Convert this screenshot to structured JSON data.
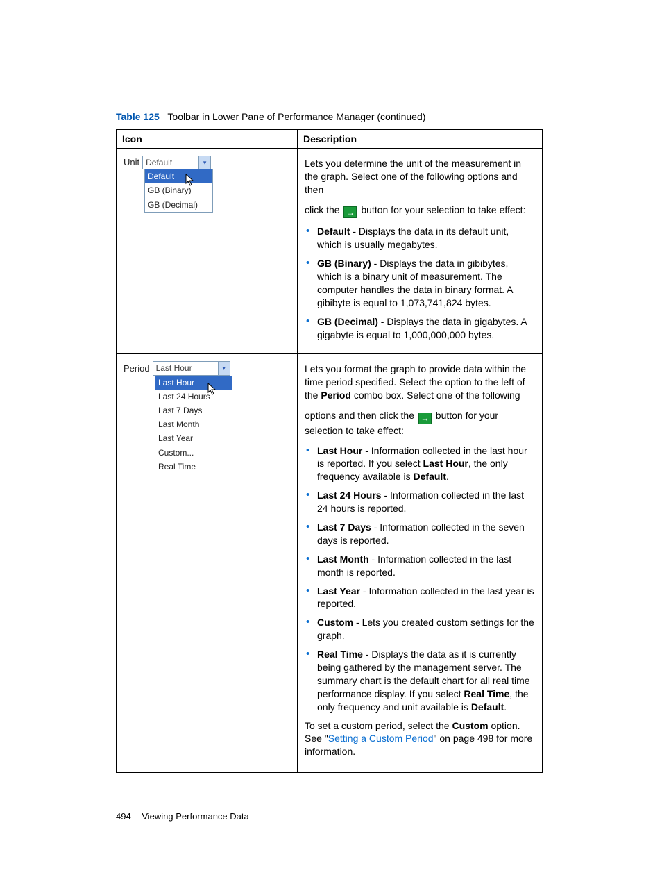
{
  "caption": {
    "label": "Table 125",
    "text": "Toolbar in Lower Pane of Performance Manager (continued)"
  },
  "headers": {
    "icon": "Icon",
    "desc": "Description"
  },
  "row1": {
    "dd_label": "Unit",
    "dd_value": "Default",
    "items": [
      "Default",
      "GB (Binary)",
      "GB (Decimal)"
    ],
    "desc_intro": "Lets you determine the unit of the measurement in the graph. Select one of the following options and then",
    "desc_click_a": "click the",
    "desc_click_b": "button for your selection to take effect:",
    "b1_label": "Default",
    "b1_text": " - Displays the data in its default unit, which is usually megabytes.",
    "b2_label": "GB (Binary)",
    "b2_text": " - Displays the data in gibibytes, which is a binary unit of measurement. The computer handles the data in binary format. A gibibyte is equal to 1,073,741,824 bytes.",
    "b3_label": "GB (Decimal)",
    "b3_text": " - Displays the data in gigabytes. A gigabyte is equal to 1,000,000,000 bytes."
  },
  "row2": {
    "dd_label": "Period",
    "dd_value": "Last Hour",
    "items": [
      "Last Hour",
      "Last 24 Hours",
      "Last 7 Days",
      "Last Month",
      "Last Year",
      "Custom...",
      "Real Time"
    ],
    "desc_intro_a": "Lets you format the graph to provide data within the time period specified. Select the option to the left of the ",
    "desc_intro_bold": "Period",
    "desc_intro_b": " combo box. Select one of the following",
    "desc_click_a": "options and then click the",
    "desc_click_b": "button for your selection to take effect:",
    "b1_label": "Last Hour",
    "b1_text_a": " - Information collected in the last hour is reported. If you select ",
    "b1_bold2": "Last Hour",
    "b1_text_b": ", the only frequency available is ",
    "b1_bold3": "Default",
    "b1_text_c": ".",
    "b2_label": "Last 24 Hours",
    "b2_text": " - Information collected in the last 24 hours is reported.",
    "b3_label": "Last 7 Days",
    "b3_text": " - Information collected in the seven days is reported.",
    "b4_label": "Last Month",
    "b4_text": " - Information collected in the last month is reported.",
    "b5_label": "Last Year",
    "b5_text": " - Information collected in the last year is reported.",
    "b6_label": "Custom",
    "b6_text": " - Lets you created custom settings for the graph.",
    "b7_label": "Real Time",
    "b7_text_a": " - Displays the data as it is currently being gathered by the management server. The summary chart is the default chart for all real time performance display. If you select ",
    "b7_bold2": "Real Time",
    "b7_text_b": ", the only frequency and unit available is ",
    "b7_bold3": "Default",
    "b7_text_c": ".",
    "outro_a": "To set a custom period, select the ",
    "outro_bold": "Custom",
    "outro_b": " option. See \"",
    "outro_link": "Setting a Custom Period",
    "outro_c": "\" on page 498 for more information."
  },
  "footer": {
    "page": "494",
    "title": "Viewing Performance Data"
  }
}
